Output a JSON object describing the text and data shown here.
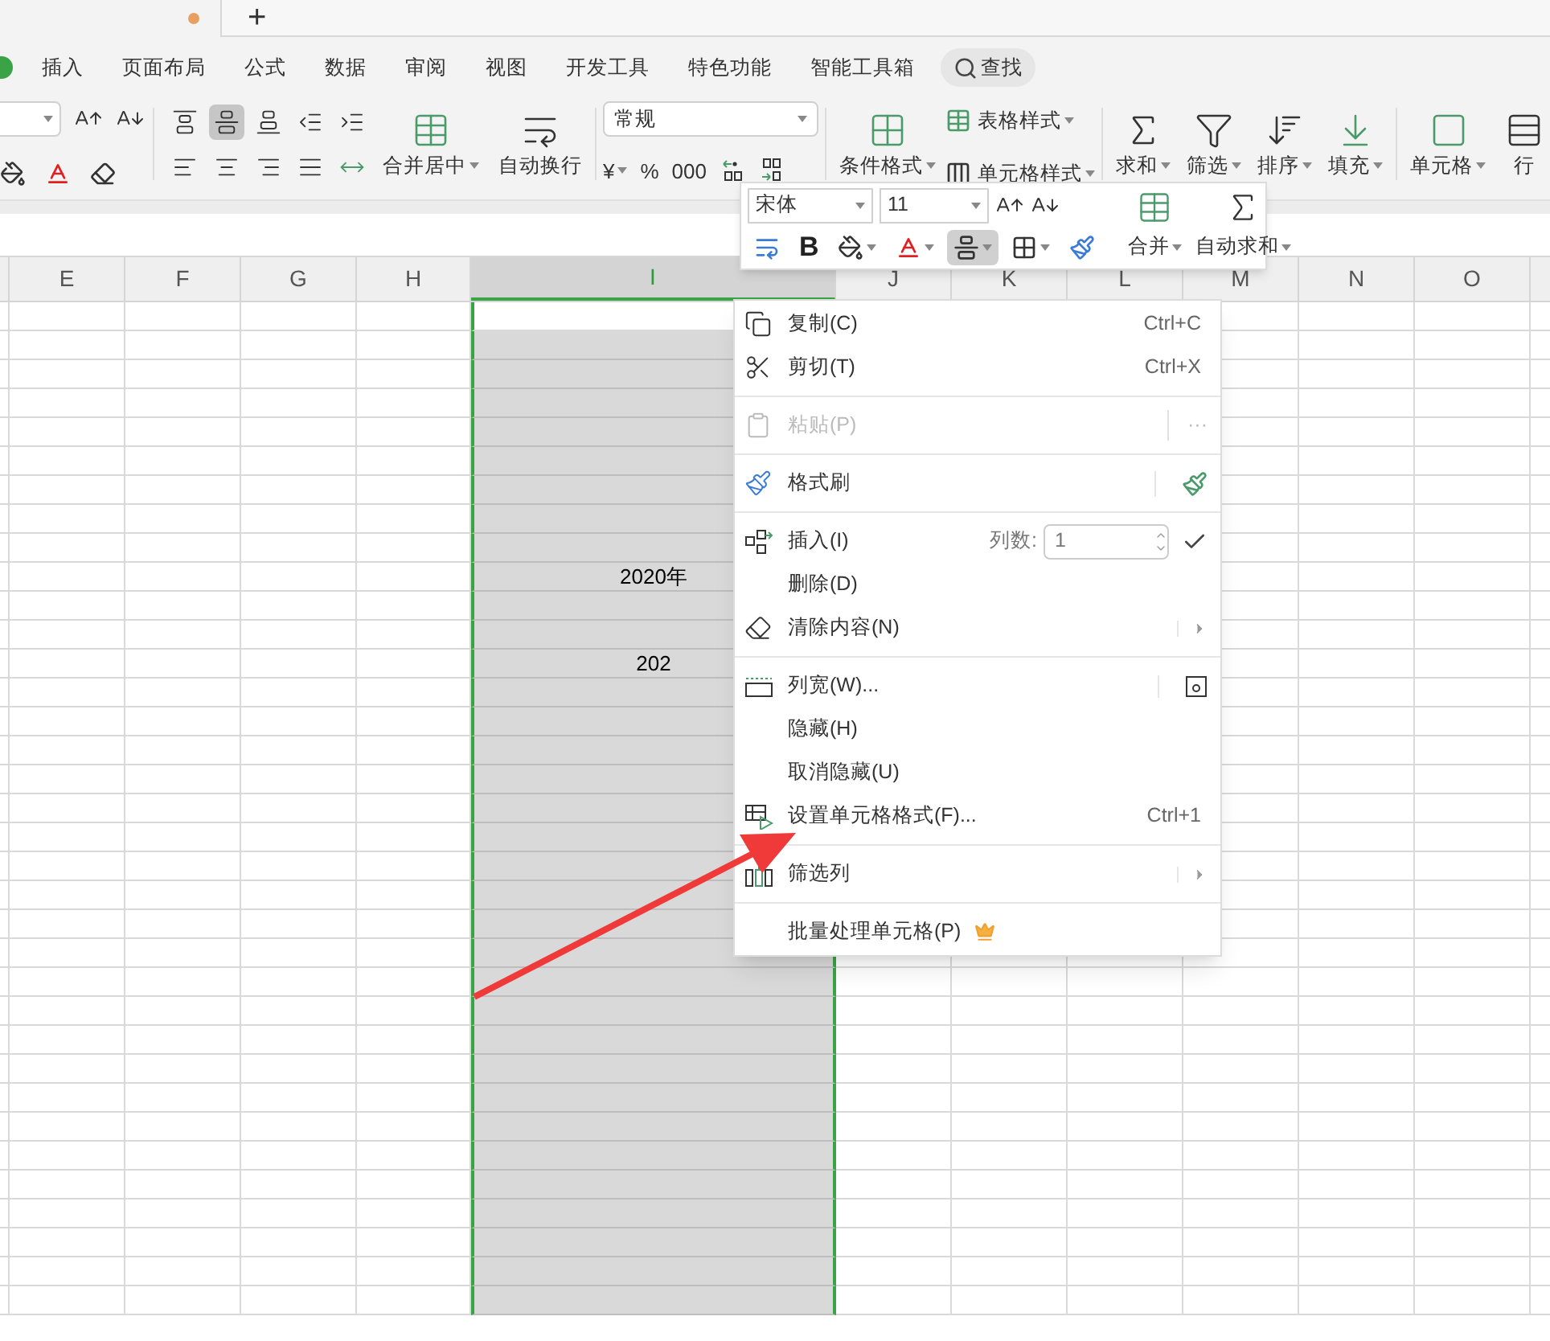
{
  "title_bar": {
    "unsaved": true,
    "new_tab": "+"
  },
  "menu_tabs": [
    {
      "label": "插入",
      "selected": false
    },
    {
      "label": "页面布局",
      "selected": false
    },
    {
      "label": "公式",
      "selected": false
    },
    {
      "label": "数据",
      "selected": false
    },
    {
      "label": "审阅",
      "selected": false
    },
    {
      "label": "视图",
      "selected": false
    },
    {
      "label": "开发工具",
      "selected": false
    },
    {
      "label": "特色功能",
      "selected": false
    },
    {
      "label": "智能工具箱",
      "selected": false
    }
  ],
  "search": {
    "label": "查找"
  },
  "ribbon": {
    "align_buttons": [
      {
        "selected": false
      },
      {
        "selected": true
      },
      {
        "selected": false
      },
      {
        "selected": false
      },
      {
        "selected": false
      },
      {
        "selected": false
      },
      {
        "selected": false
      },
      {
        "selected": false
      },
      {
        "selected": false
      },
      {
        "selected": false
      }
    ],
    "merge_buttons": [
      {
        "label": "合并居中",
        "dropdown": true
      },
      {
        "label": "自动换行",
        "dropdown": false
      }
    ],
    "number_format": "常规",
    "number_buttons": [
      {
        "label": "¥",
        "dropdown": true
      },
      {
        "label": "%",
        "dropdown": false
      },
      {
        "label": "000",
        "dropdown": false
      }
    ],
    "style_big": {
      "label": "条件格式",
      "dropdown": true
    },
    "style_small": [
      {
        "label": "表格样式",
        "dropdown": true
      },
      {
        "label": "单元格样式",
        "dropdown": true
      }
    ],
    "edit_buttons": [
      {
        "label": "求和",
        "dropdown": true
      },
      {
        "label": "筛选",
        "dropdown": true
      },
      {
        "label": "排序",
        "dropdown": true
      },
      {
        "label": "填充",
        "dropdown": true
      }
    ],
    "cell_buttons": [
      {
        "label": "单元格",
        "dropdown": true
      },
      {
        "label": "行",
        "dropdown": false
      }
    ]
  },
  "columns": [
    {
      "label": "E",
      "selected": false
    },
    {
      "label": "F",
      "selected": false
    },
    {
      "label": "G",
      "selected": false
    },
    {
      "label": "H",
      "selected": false
    },
    {
      "label": "I",
      "selected": true
    },
    {
      "label": "J",
      "selected": false
    },
    {
      "label": "K",
      "selected": false
    },
    {
      "label": "L",
      "selected": false
    },
    {
      "label": "M",
      "selected": false
    },
    {
      "label": "N",
      "selected": false
    },
    {
      "label": "O",
      "selected": false
    }
  ],
  "cells": [
    {
      "text": "2020年"
    },
    {
      "text": "202"
    }
  ],
  "mini_toolbar": {
    "font": "宋体",
    "size": "11",
    "tools": [
      {
        "kind": "wrap",
        "selected": false
      },
      {
        "kind": "bold",
        "label": "B",
        "selected": false
      },
      {
        "kind": "fill",
        "selected": false
      },
      {
        "kind": "font-color",
        "selected": false
      },
      {
        "kind": "align",
        "selected": true
      },
      {
        "kind": "border",
        "selected": false
      },
      {
        "kind": "brush",
        "selected": false
      }
    ],
    "buttons": [
      {
        "label": "合并",
        "dropdown": true
      },
      {
        "label": "自动求和",
        "dropdown": true
      }
    ]
  },
  "context_menu": [
    {
      "kind": "item",
      "label": "复制(C)",
      "shortcut": "Ctrl+C",
      "disabled": false
    },
    {
      "kind": "item",
      "label": "剪切(T)",
      "shortcut": "Ctrl+X",
      "disabled": false
    },
    {
      "kind": "separator"
    },
    {
      "kind": "item",
      "label": "粘贴(P)",
      "more": "···",
      "disabled": true
    },
    {
      "kind": "separator"
    },
    {
      "kind": "item",
      "label": "格式刷",
      "disabled": false
    },
    {
      "kind": "separator"
    },
    {
      "kind": "insert",
      "label": "插入(I)",
      "count_label": "列数:",
      "count": "1",
      "disabled": false
    },
    {
      "kind": "item",
      "label": "删除(D)",
      "disabled": false
    },
    {
      "kind": "item",
      "label": "清除内容(N)",
      "submenu": true,
      "disabled": false
    },
    {
      "kind": "separator"
    },
    {
      "kind": "item",
      "label": "列宽(W)...",
      "disabled": false
    },
    {
      "kind": "item",
      "label": "隐藏(H)",
      "disabled": false
    },
    {
      "kind": "item",
      "label": "取消隐藏(U)",
      "disabled": false
    },
    {
      "kind": "item",
      "label": "设置单元格格式(F)...",
      "shortcut": "Ctrl+1",
      "disabled": false
    },
    {
      "kind": "separator"
    },
    {
      "kind": "item",
      "label": "筛选列",
      "submenu": true,
      "disabled": false
    },
    {
      "kind": "separator"
    },
    {
      "kind": "item",
      "label": "批量处理单元格(P)",
      "premium": true,
      "disabled": false
    }
  ],
  "annotation": {
    "kind": "arrow"
  }
}
